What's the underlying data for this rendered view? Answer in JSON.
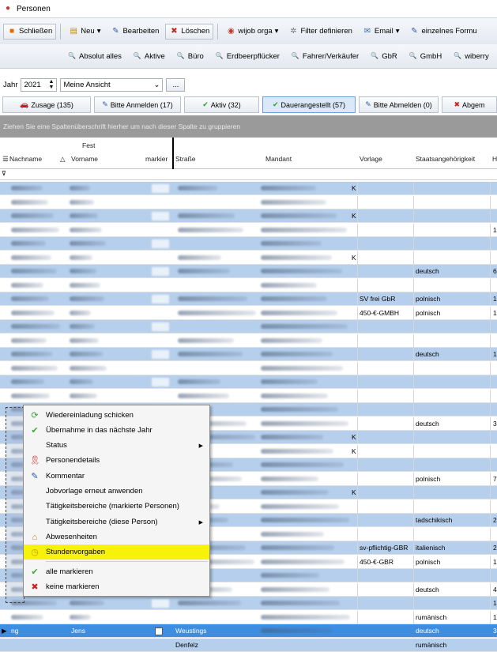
{
  "window": {
    "title": "Personen"
  },
  "toolbar1": {
    "close_label": "Schließen",
    "new_label": "Neu",
    "edit_label": "Bearbeiten",
    "delete_label": "Löschen",
    "wijob_label": "wijob orga",
    "filter_label": "Filter definieren",
    "email_label": "Email",
    "single_form_label": "einzelnes Formu"
  },
  "toolbar2": {
    "filters": [
      "Absolut alles",
      "Aktive",
      "Büro",
      "Erdbeerpflücker",
      "Fahrer/Verkäufer",
      "GbR",
      "GmbH",
      "wiberry"
    ]
  },
  "filterbar": {
    "year_label": "Jahr",
    "year_value": "2021",
    "view_value": "Meine Ansicht",
    "more_label": "..."
  },
  "tabs": [
    {
      "label": "Zusage (135)",
      "icon": "car-icon"
    },
    {
      "label": "Bitte Anmelden (17)",
      "icon": "pencil-icon"
    },
    {
      "label": "Aktiv (32)",
      "icon": "check-icon"
    },
    {
      "label": "Dauerangestellt (57)",
      "icon": "check-icon",
      "active": true
    },
    {
      "label": "Bitte Abmelden (0)",
      "icon": "pencil-icon"
    },
    {
      "label": "Abgem",
      "icon": "x-icon"
    }
  ],
  "grid": {
    "group_hint": "Ziehen Sie eine Spaltenüberschrift hierher um nach dieser Spalte zu gruppieren",
    "columns": {
      "nachname": "Nachname",
      "fest": "Fest",
      "vorname": "Vorname",
      "markier": "markier",
      "strasse": "Straße",
      "mandant": "Mandant",
      "vorlage": "Vorlage",
      "staatsangehoerigkeit": "Staatsangehörigkeit",
      "h": "H"
    },
    "rows": [
      {
        "vorlage": "",
        "staat": "",
        "h": "",
        "k": "K"
      },
      {
        "vorlage": "",
        "staat": "",
        "h": "",
        "k": ""
      },
      {
        "vorlage": "",
        "staat": "",
        "h": "",
        "k": "K"
      },
      {
        "vorlage": "",
        "staat": "",
        "h": "1",
        "k": ""
      },
      {
        "vorlage": "",
        "staat": "",
        "h": "",
        "k": ""
      },
      {
        "vorlage": "",
        "staat": "",
        "h": "",
        "k": "K"
      },
      {
        "vorlage": "",
        "staat": "deutsch",
        "h": "6",
        "k": ""
      },
      {
        "vorlage": "",
        "staat": "",
        "h": "",
        "k": ""
      },
      {
        "vorlage": "SV frei GbR",
        "staat": "polnisch",
        "h": "1",
        "k": ""
      },
      {
        "vorlage": "450-€-GMBH",
        "staat": "polnisch",
        "h": "1",
        "k": ""
      },
      {
        "vorlage": "",
        "staat": "",
        "h": "",
        "k": ""
      },
      {
        "vorlage": "",
        "staat": "",
        "h": "",
        "k": ""
      },
      {
        "vorlage": "",
        "staat": "deutsch",
        "h": "1",
        "k": ""
      },
      {
        "vorlage": "",
        "staat": "",
        "h": "",
        "k": ""
      },
      {
        "vorlage": "",
        "staat": "",
        "h": "",
        "k": ""
      },
      {
        "vorlage": "",
        "staat": "",
        "h": "",
        "k": ""
      },
      {
        "vorlage": "",
        "staat": "",
        "h": "",
        "k": ""
      },
      {
        "vorlage": "",
        "staat": "deutsch",
        "h": "3",
        "k": ""
      },
      {
        "vorlage": "",
        "staat": "",
        "h": "",
        "k": "K"
      },
      {
        "vorlage": "",
        "staat": "",
        "h": "",
        "k": "K"
      },
      {
        "vorlage": "",
        "staat": "",
        "h": "",
        "k": ""
      },
      {
        "vorlage": "",
        "staat": "polnisch",
        "h": "7",
        "k": ""
      },
      {
        "vorlage": "",
        "staat": "",
        "h": "",
        "k": "K"
      },
      {
        "vorlage": "",
        "staat": "",
        "h": "",
        "k": ""
      },
      {
        "vorlage": "",
        "staat": "tadschikisch",
        "h": "2",
        "k": ""
      },
      {
        "vorlage": "",
        "staat": "",
        "h": "",
        "k": ""
      },
      {
        "vorlage": "sv-pflichtig-GBR",
        "staat": "italienisch",
        "h": "2",
        "k": ""
      },
      {
        "vorlage": "450-€-GBR",
        "staat": "polnisch",
        "h": "1",
        "k": ""
      },
      {
        "vorlage": "",
        "staat": "",
        "h": "",
        "k": ""
      },
      {
        "vorlage": "",
        "staat": "deutsch",
        "h": "4",
        "k": ""
      },
      {
        "vorlage": "",
        "staat": "",
        "h": "1",
        "k": ""
      },
      {
        "vorlage": "",
        "staat": "rumänisch",
        "h": "1",
        "k": ""
      }
    ],
    "selected_row": {
      "nachname": "ng",
      "vorname": "Jens",
      "strasse": "Weustings",
      "staat": "deutsch",
      "h": "3"
    },
    "last_row": {
      "strasse": "Denfelz",
      "staat": "rumänisch"
    }
  },
  "context_menu": {
    "items": [
      {
        "label": "Wiedereinladung schicken",
        "icon": "refresh-icon"
      },
      {
        "label": "Übernahme in das nächste Jahr",
        "icon": "check-icon"
      },
      {
        "label": "Status",
        "icon": "",
        "submenu": true
      },
      {
        "label": "Personendetails",
        "icon": "ribbon-icon"
      },
      {
        "label": "Kommentar",
        "icon": "pencil-icon"
      },
      {
        "label": "Jobvorlage erneut anwenden",
        "icon": ""
      },
      {
        "label": "Tätigkeitsbereiche (markierte Personen)",
        "icon": ""
      },
      {
        "label": "Tätigkeitsbereiche (diese Person)",
        "icon": "",
        "submenu": true
      },
      {
        "label": "Abwesenheiten",
        "icon": "house-icon"
      },
      {
        "label": "Stundenvorgaben",
        "icon": "clock-icon",
        "highlighted": true
      },
      {
        "label": "alle markieren",
        "icon": "check-icon"
      },
      {
        "label": "keine markieren",
        "icon": "x-icon"
      }
    ],
    "highlight_color": "#f7f20a"
  },
  "colors": {
    "alt_row": "#b6cfec",
    "selected_row": "#3d8ee0",
    "group_band": "#9a9a9a"
  }
}
